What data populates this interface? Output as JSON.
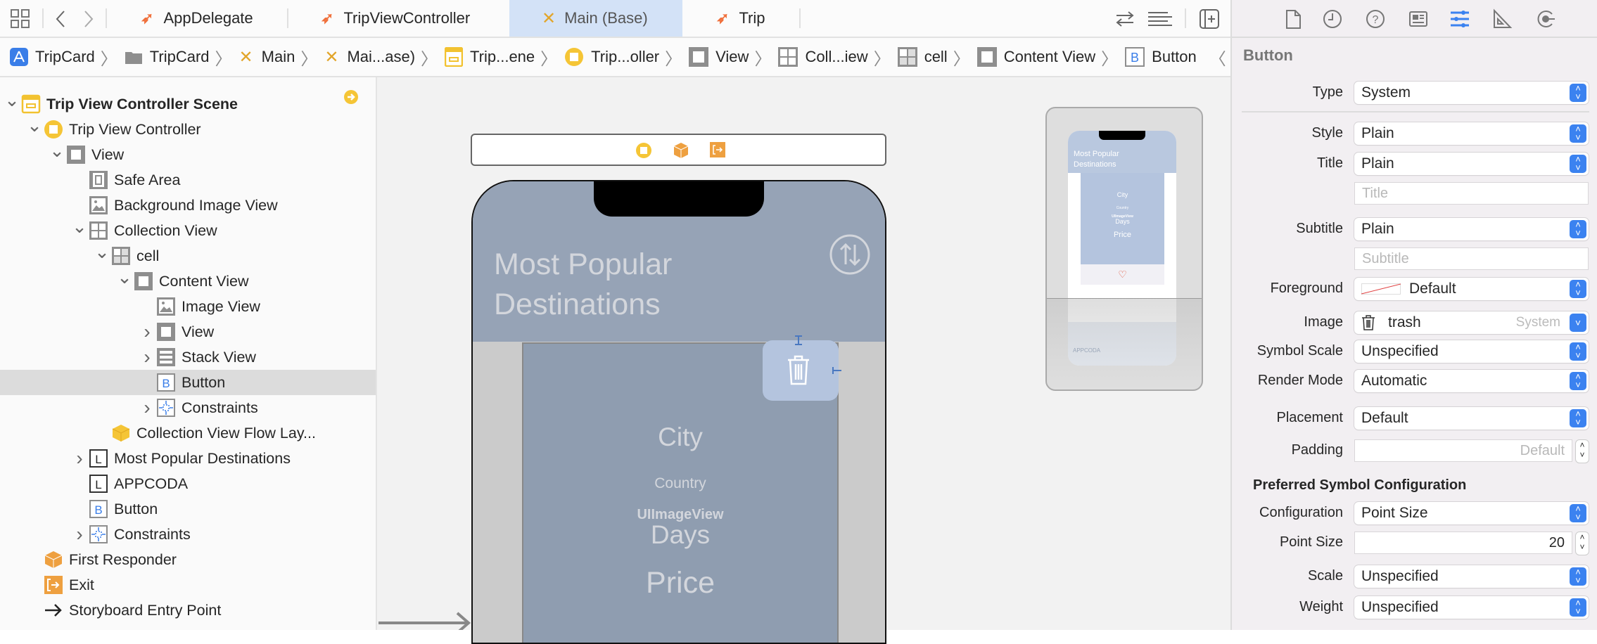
{
  "tabs": {
    "items": [
      {
        "label": "AppDelegate",
        "icon": "swift-icon"
      },
      {
        "label": "TripViewController",
        "icon": "swift-icon"
      },
      {
        "label": "Main (Base)",
        "icon": "storyboard-icon",
        "active": true
      },
      {
        "label": "Trip",
        "icon": "swift-icon"
      }
    ]
  },
  "breadcrumb": [
    "TripCard",
    "TripCard",
    "Main",
    "Mai...ase)",
    "Trip...ene",
    "Trip...oller",
    "View",
    "Coll...iew",
    "cell",
    "Content View",
    "Button"
  ],
  "outline": [
    {
      "label": "Trip View Controller Scene",
      "level": 0,
      "chevron": "down",
      "icon": "scene",
      "bold": true
    },
    {
      "label": "Trip View Controller",
      "level": 1,
      "chevron": "down",
      "icon": "vc"
    },
    {
      "label": "View",
      "level": 2,
      "chevron": "down",
      "icon": "view"
    },
    {
      "label": "Safe Area",
      "level": 3,
      "chevron": "",
      "icon": "safearea"
    },
    {
      "label": "Background Image View",
      "level": 3,
      "chevron": "",
      "icon": "image"
    },
    {
      "label": "Collection View",
      "level": 3,
      "chevron": "down",
      "icon": "collection"
    },
    {
      "label": "cell",
      "level": 4,
      "chevron": "down",
      "icon": "cell"
    },
    {
      "label": "Content View",
      "level": 5,
      "chevron": "down",
      "icon": "view"
    },
    {
      "label": "Image View",
      "level": 6,
      "chevron": "",
      "icon": "image"
    },
    {
      "label": "View",
      "level": 6,
      "chevron": "right",
      "icon": "view"
    },
    {
      "label": "Stack View",
      "level": 6,
      "chevron": "right",
      "icon": "stack"
    },
    {
      "label": "Button",
      "level": 6,
      "chevron": "",
      "icon": "button",
      "selected": true
    },
    {
      "label": "Constraints",
      "level": 6,
      "chevron": "right",
      "icon": "constraints"
    },
    {
      "label": "Collection View Flow Lay...",
      "level": 4,
      "chevron": "",
      "icon": "layout"
    },
    {
      "label": "Most Popular Destinations",
      "level": 3,
      "chevron": "right",
      "icon": "label"
    },
    {
      "label": "APPCODA",
      "level": 3,
      "chevron": "",
      "icon": "label"
    },
    {
      "label": "Button",
      "level": 3,
      "chevron": "",
      "icon": "button"
    },
    {
      "label": "Constraints",
      "level": 3,
      "chevron": "right",
      "icon": "constraints"
    },
    {
      "label": "First Responder",
      "level": 1,
      "chevron": "",
      "icon": "responder"
    },
    {
      "label": "Exit",
      "level": 1,
      "chevron": "",
      "icon": "exit"
    },
    {
      "label": "Storyboard Entry Point",
      "level": 1,
      "chevron": "",
      "icon": "entry"
    }
  ],
  "canvas": {
    "title_line1": "Most Popular",
    "title_line2": "Destinations",
    "city": "City",
    "country": "Country",
    "image_view": "UIImageView",
    "days": "Days",
    "price": "Price",
    "mini_title_line1": "Most Popular",
    "mini_title_line2": "Destinations",
    "mini_footer": "APPCODA"
  },
  "inspector": {
    "title": "Button",
    "type": {
      "label": "Type",
      "value": "System"
    },
    "style": {
      "label": "Style",
      "value": "Plain"
    },
    "title_field": {
      "label": "Title",
      "value": "Plain",
      "placeholder": "Title"
    },
    "subtitle": {
      "label": "Subtitle",
      "value": "Plain",
      "placeholder": "Subtitle"
    },
    "foreground": {
      "label": "Foreground",
      "value": "Default"
    },
    "image": {
      "label": "Image",
      "value": "trash",
      "source": "System"
    },
    "symbol_scale": {
      "label": "Symbol Scale",
      "value": "Unspecified"
    },
    "render_mode": {
      "label": "Render Mode",
      "value": "Automatic"
    },
    "placement": {
      "label": "Placement",
      "value": "Default"
    },
    "padding": {
      "label": "Padding",
      "placeholder": "Default"
    },
    "section": "Preferred Symbol Configuration",
    "configuration": {
      "label": "Configuration",
      "value": "Point Size"
    },
    "point_size": {
      "label": "Point Size",
      "value": "20"
    },
    "scale": {
      "label": "Scale",
      "value": "Unspecified"
    },
    "weight": {
      "label": "Weight",
      "value": "Unspecified"
    }
  },
  "colors": {
    "accent": "#3b82f0",
    "phone_header": "#96a3b6",
    "cell": "#8f9db0",
    "selection": "#b4c4de"
  }
}
